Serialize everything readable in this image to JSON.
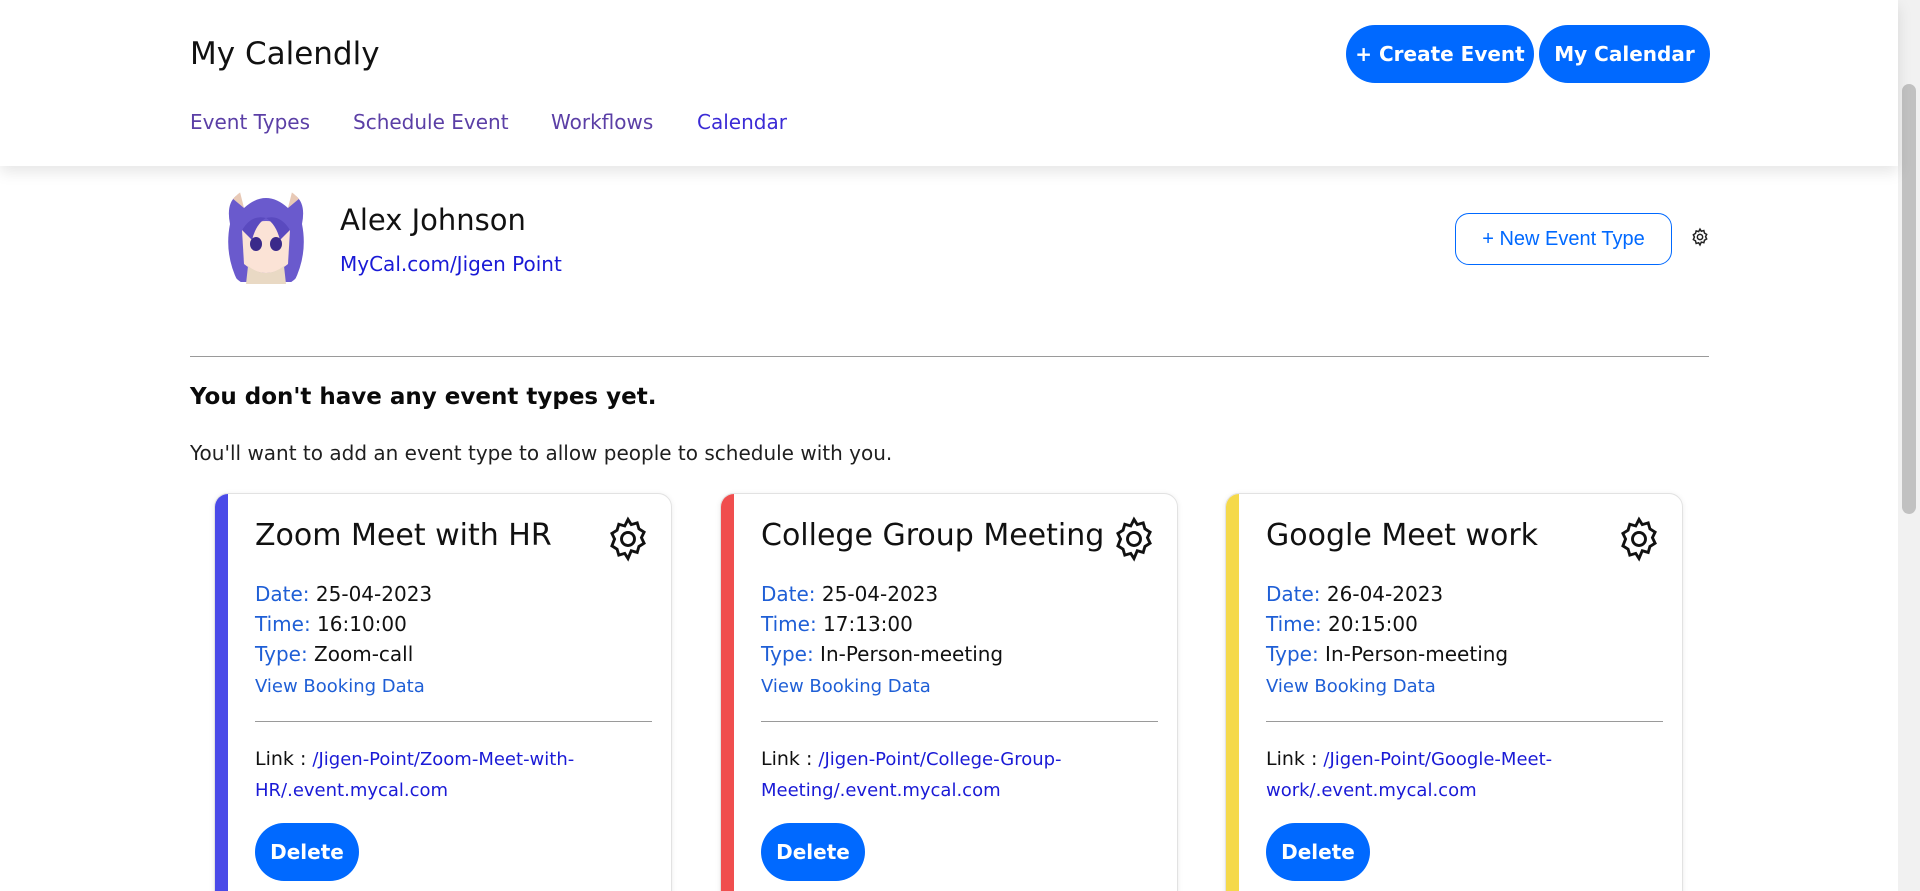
{
  "header": {
    "brand": "My Calendly",
    "create_event_label": "+ Create Event",
    "my_calendar_label": "My Calendar",
    "nav": [
      {
        "label": "Event Types"
      },
      {
        "label": "Schedule Event"
      },
      {
        "label": "Workflows"
      },
      {
        "label": "Calendar"
      }
    ]
  },
  "profile": {
    "name": "Alex Johnson",
    "link": "MyCal.com/Jigen Point",
    "new_event_type_label": "+ New Event Type"
  },
  "empty_state": {
    "title": "You don't have any event types yet.",
    "subtitle": "You'll want to add an event type to allow people to schedule with you."
  },
  "labels": {
    "date": "Date:",
    "time": "Time:",
    "type": "Type:",
    "view_booking": "View Booking Data",
    "link": "Link :",
    "delete": "Delete"
  },
  "events": [
    {
      "title": "Zoom Meet with HR",
      "date": "25-04-2023",
      "time": "16:10:00",
      "type": "Zoom-call",
      "url": "/Jigen-Point/Zoom-Meet-with-HR/.event.mycal.com",
      "color": "#4a4ae8"
    },
    {
      "title": "College Group Meeting",
      "date": "25-04-2023",
      "time": "17:13:00",
      "type": "In-Person-meeting",
      "url": "/Jigen-Point/College-Group-Meeting/.event.mycal.com",
      "color": "#f04e4e"
    },
    {
      "title": "Google Meet work",
      "date": "26-04-2023",
      "time": "20:15:00",
      "type": "In-Person-meeting",
      "url": "/Jigen-Point/Google-Meet-work/.event.mycal.com",
      "color": "#f5d94a"
    }
  ],
  "colors": {
    "accent": "#0069ff",
    "nav": "#5b3fa6",
    "link": "#1a1ad6"
  }
}
